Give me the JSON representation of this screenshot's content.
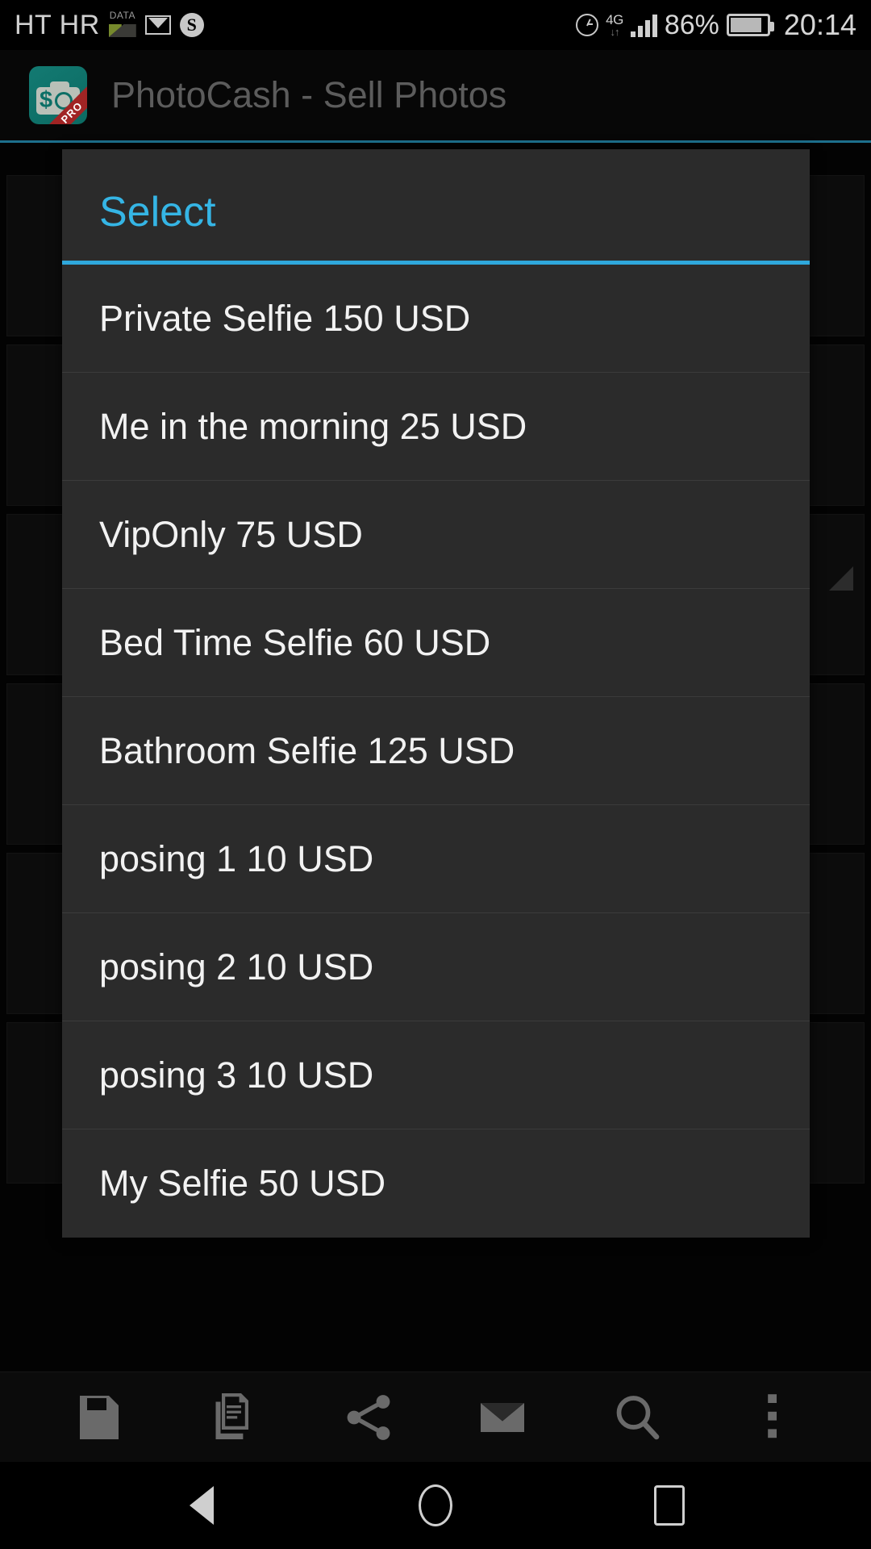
{
  "status_bar": {
    "carrier": "HT HR",
    "data_label": "DATA",
    "network": "4G",
    "network_arrows": "↓↑",
    "battery_percent": "86%",
    "battery_level": 86,
    "clock": "20:14",
    "icons": [
      "data-icon",
      "gmail-icon",
      "skype-icon",
      "alarm-icon",
      "signal-icon",
      "battery-icon"
    ],
    "skype_glyph": "S"
  },
  "app_bar": {
    "title": "PhotoCash - Sell Photos",
    "icon_name": "photocash-app-icon",
    "icon_badge": "PRO",
    "icon_dollar": "$",
    "accent_color": "#1d6f8c",
    "icon_bg_color": "#0e7a70"
  },
  "dialog": {
    "title": "Select",
    "title_color": "#35b5e5",
    "accent_color": "#2fa8dc",
    "background_color": "#2b2b2b",
    "items": [
      {
        "label": "Private Selfie 150 USD",
        "name": "Private Selfie",
        "price": 150,
        "currency": "USD"
      },
      {
        "label": "Me in the morning 25 USD",
        "name": "Me in the morning",
        "price": 25,
        "currency": "USD"
      },
      {
        "label": "VipOnly 75 USD",
        "name": "VipOnly",
        "price": 75,
        "currency": "USD"
      },
      {
        "label": "Bed Time Selfie 60 USD",
        "name": "Bed Time Selfie",
        "price": 60,
        "currency": "USD"
      },
      {
        "label": "Bathroom Selfie 125 USD",
        "name": "Bathroom Selfie",
        "price": 125,
        "currency": "USD"
      },
      {
        "label": "posing 1 10 USD",
        "name": "posing 1",
        "price": 10,
        "currency": "USD"
      },
      {
        "label": "posing 2 10 USD",
        "name": "posing 2",
        "price": 10,
        "currency": "USD"
      },
      {
        "label": "posing 3 10 USD",
        "name": "posing 3",
        "price": 10,
        "currency": "USD"
      },
      {
        "label": "My Selfie 50 USD",
        "name": "My Selfie",
        "price": 50,
        "currency": "USD"
      }
    ]
  },
  "bottom_toolbar": {
    "buttons": [
      {
        "icon": "save-icon",
        "label": "Save"
      },
      {
        "icon": "copy-icon",
        "label": "Copy"
      },
      {
        "icon": "share-icon",
        "label": "Share"
      },
      {
        "icon": "email-icon",
        "label": "Email"
      },
      {
        "icon": "search-icon",
        "label": "Search"
      },
      {
        "icon": "overflow-menu-icon",
        "label": "More options"
      }
    ]
  },
  "nav_bar": {
    "buttons": [
      {
        "icon": "back-icon",
        "label": "Back"
      },
      {
        "icon": "home-icon",
        "label": "Home"
      },
      {
        "icon": "recents-icon",
        "label": "Recents"
      }
    ]
  }
}
